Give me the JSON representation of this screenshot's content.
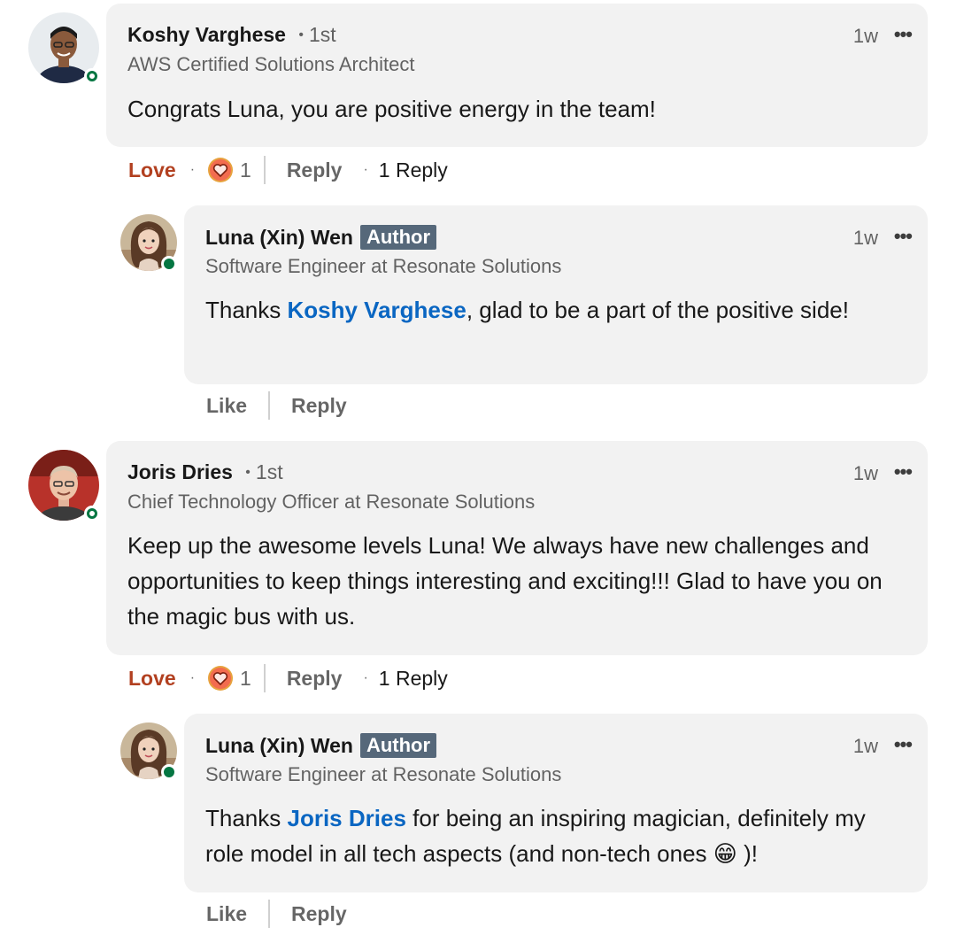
{
  "colors": {
    "accent_link": "#0a66c2",
    "love": "#b24020",
    "presence": "#057642",
    "author_badge": "#56687a",
    "bubble": "#f2f2f2"
  },
  "comments": [
    {
      "author": "Koshy Varghese",
      "degree": "1st",
      "headline": "AWS Certified Solutions Architect",
      "text": "Congrats Luna, you are positive energy in the team!",
      "time": "1w",
      "more_icon": "•••",
      "reaction_label": "Love",
      "reaction_icon": "heart-icon",
      "reaction_count": "1",
      "reply_label": "Reply",
      "replies_label": "1 Reply",
      "reply": {
        "author": "Luna (Xin) Wen",
        "badge": "Author",
        "headline": "Software Engineer at Resonate Solutions",
        "text_before": "Thanks ",
        "mention": "Koshy Varghese",
        "text_after": ", glad to be a part of the positive side!",
        "time": "1w",
        "more_icon": "•••",
        "like_label": "Like",
        "reply_label": "Reply"
      }
    },
    {
      "author": "Joris Dries",
      "degree": "1st",
      "headline": "Chief Technology Officer at Resonate Solutions",
      "text": "Keep up the awesome levels Luna! We always have new challenges and opportunities to keep things interesting and exciting!!! Glad to have you on the magic bus with us.",
      "time": "1w",
      "more_icon": "•••",
      "reaction_label": "Love",
      "reaction_icon": "heart-icon",
      "reaction_count": "1",
      "reply_label": "Reply",
      "replies_label": "1 Reply",
      "reply": {
        "author": "Luna (Xin) Wen",
        "badge": "Author",
        "headline": "Software Engineer at Resonate Solutions",
        "text_before": "Thanks ",
        "mention": "Joris Dries",
        "text_after": " for being an inspiring magician, definitely my role model in all tech aspects (and non-tech ones 😁 )!",
        "time": "1w",
        "more_icon": "•••",
        "like_label": "Like",
        "reply_label": "Reply"
      }
    }
  ]
}
